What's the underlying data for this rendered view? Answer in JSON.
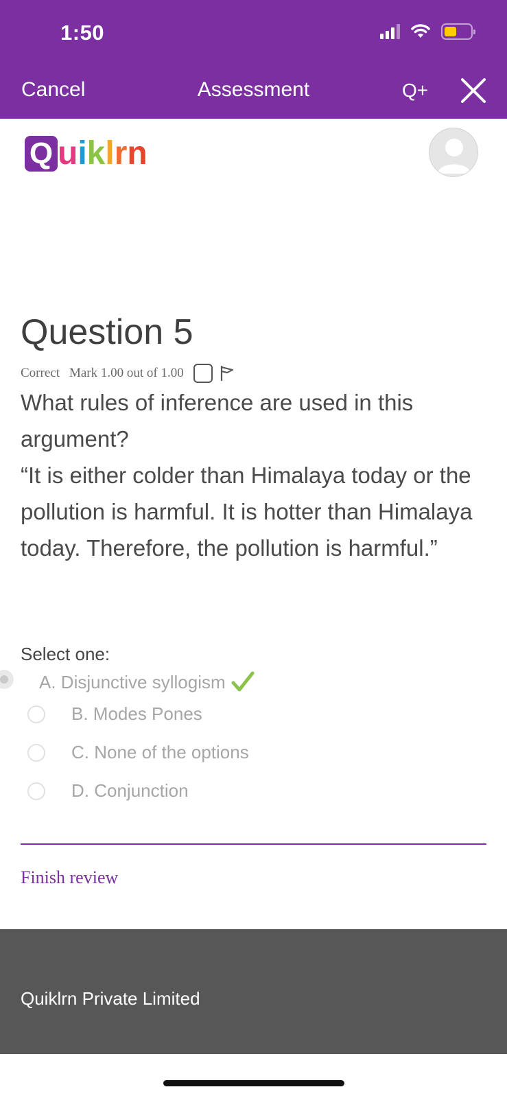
{
  "status_bar": {
    "time": "1:50"
  },
  "nav": {
    "cancel_label": "Cancel",
    "title": "Assessment",
    "qplus_label": "Q+"
  },
  "brand": {
    "logo_q": "Q",
    "logo_rest": [
      "u",
      "i",
      "k",
      "l",
      "r",
      "n"
    ],
    "logo_colors": [
      "#e63982",
      "#1e9ad6",
      "#8bc43f",
      "#f5a623",
      "#ef6c2c",
      "#e8452f"
    ]
  },
  "question": {
    "title": "Question 5",
    "state": "Correct",
    "mark": "Mark 1.00 out of 1.00",
    "text_lines": [
      "What rules of inference are used in this argument?",
      "“It is either colder than Himalaya today or the pollution is harmful. It is hotter than Himalaya today. Therefore, the pollution is harmful.”"
    ]
  },
  "answers": {
    "prompt": "Select one:",
    "options": [
      {
        "label": "A. Disjunctive syllogism",
        "selected": true,
        "correct": true
      },
      {
        "label": "B. Modes Pones",
        "selected": false
      },
      {
        "label": "C. None of the options",
        "selected": false
      },
      {
        "label": "D. Conjunction",
        "selected": false
      }
    ]
  },
  "finish_label": "Finish review",
  "footer": {
    "company": "Quiklrn Private Limited"
  },
  "colors": {
    "brand_purple": "#7b2fa0",
    "correct_green": "#8bc34a",
    "footer_gray": "#575757"
  }
}
